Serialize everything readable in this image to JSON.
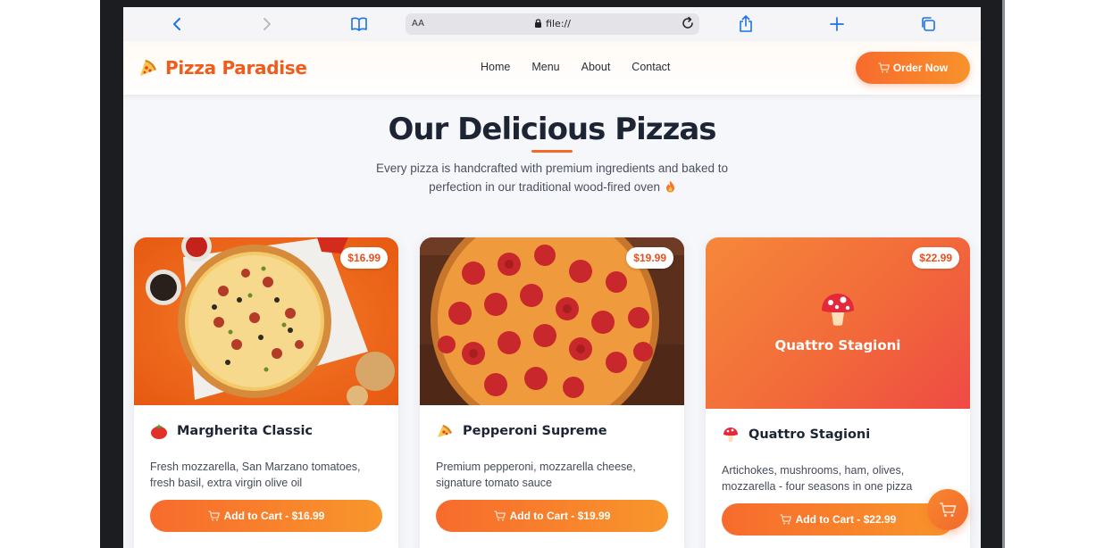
{
  "browser": {
    "text_size_label": "AA",
    "url": "file://"
  },
  "header": {
    "brand": "Pizza Paradise",
    "nav": [
      "Home",
      "Menu",
      "About",
      "Contact"
    ],
    "order_label": "Order Now"
  },
  "hero": {
    "title": "Our Delicious Pizzas",
    "subtitle_line1": "Every pizza is handcrafted with premium ingredients and baked to",
    "subtitle_line2": "perfection in our traditional wood-fired oven"
  },
  "pizzas": [
    {
      "price": "$16.99",
      "name": "Margherita Classic",
      "icon": "tomato-icon",
      "desc_line1": "Fresh mozzarella, San Marzano tomatoes,",
      "desc_line2": "fresh basil, extra virgin olive oil",
      "button": "Add to Cart - $16.99"
    },
    {
      "price": "$19.99",
      "name": "Pepperoni Supreme",
      "icon": "pizza-icon",
      "desc_line1": "Premium pepperoni, mozzarella cheese,",
      "desc_line2": "signature tomato sauce",
      "button": "Add to Cart - $19.99"
    },
    {
      "price": "$22.99",
      "name": "Quattro Stagioni",
      "image_label": "Quattro Stagioni",
      "icon": "mushroom-icon",
      "desc_line1": "Artichokes, mushrooms, ham, olives,",
      "desc_line2": "mozzarella - four seasons in one pizza",
      "button": "Add to Cart - $22.99"
    }
  ],
  "colors": {
    "accent": "#f26b26",
    "heading": "#1d2535",
    "background": "#f6f7fa"
  }
}
